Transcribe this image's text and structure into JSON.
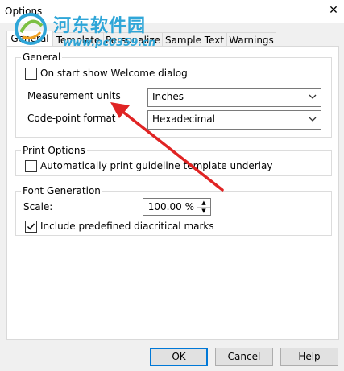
{
  "window": {
    "title": "Options",
    "close_glyph": "✕"
  },
  "watermark": {
    "title": "河东软件园",
    "url": "www.pc0359.cn"
  },
  "tabs": [
    {
      "label": "General",
      "active": true
    },
    {
      "label": "Template",
      "active": false
    },
    {
      "label": "Personalize",
      "active": false
    },
    {
      "label": "Sample Text",
      "active": false
    },
    {
      "label": "Warnings",
      "active": false
    }
  ],
  "general": {
    "title": "General",
    "welcome_checkbox": {
      "label": "On start show Welcome dialog",
      "checked": false
    },
    "measurement": {
      "label": "Measurement units",
      "value": "Inches"
    },
    "codepoint": {
      "label": "Code-point format",
      "value": "Hexadecimal"
    }
  },
  "print": {
    "title": "Print Options",
    "guideline_checkbox": {
      "label": "Automatically print guideline template underlay",
      "checked": false
    }
  },
  "font": {
    "title": "Font Generation",
    "scale": {
      "label": "Scale:",
      "value": "100.00 %"
    },
    "diacritical_checkbox": {
      "label": "Include predefined diacritical marks",
      "checked": true
    }
  },
  "buttons": {
    "ok": "OK",
    "cancel": "Cancel",
    "help": "Help"
  },
  "colors": {
    "accent": "#0078d7",
    "arrow": "#e02424",
    "watermark": "#2fa6d8"
  }
}
